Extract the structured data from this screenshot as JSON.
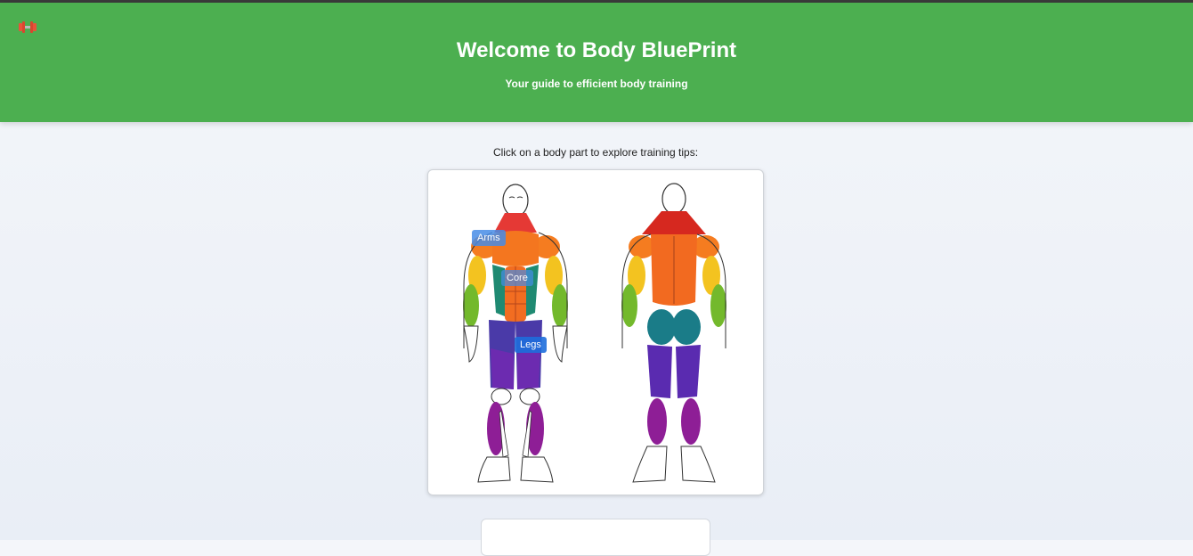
{
  "header": {
    "title": "Welcome to Body BluePrint",
    "subtitle": "Your guide to efficient body training",
    "logo_icon": "dumbbell-icon"
  },
  "main": {
    "instruction": "Click on a body part to explore training tips:",
    "hotspots": [
      {
        "label": "Arms"
      },
      {
        "label": "Core"
      },
      {
        "label": "Legs"
      }
    ]
  },
  "colors": {
    "header_bg": "#4caf50",
    "hotspot_bg": "#468ce6"
  }
}
